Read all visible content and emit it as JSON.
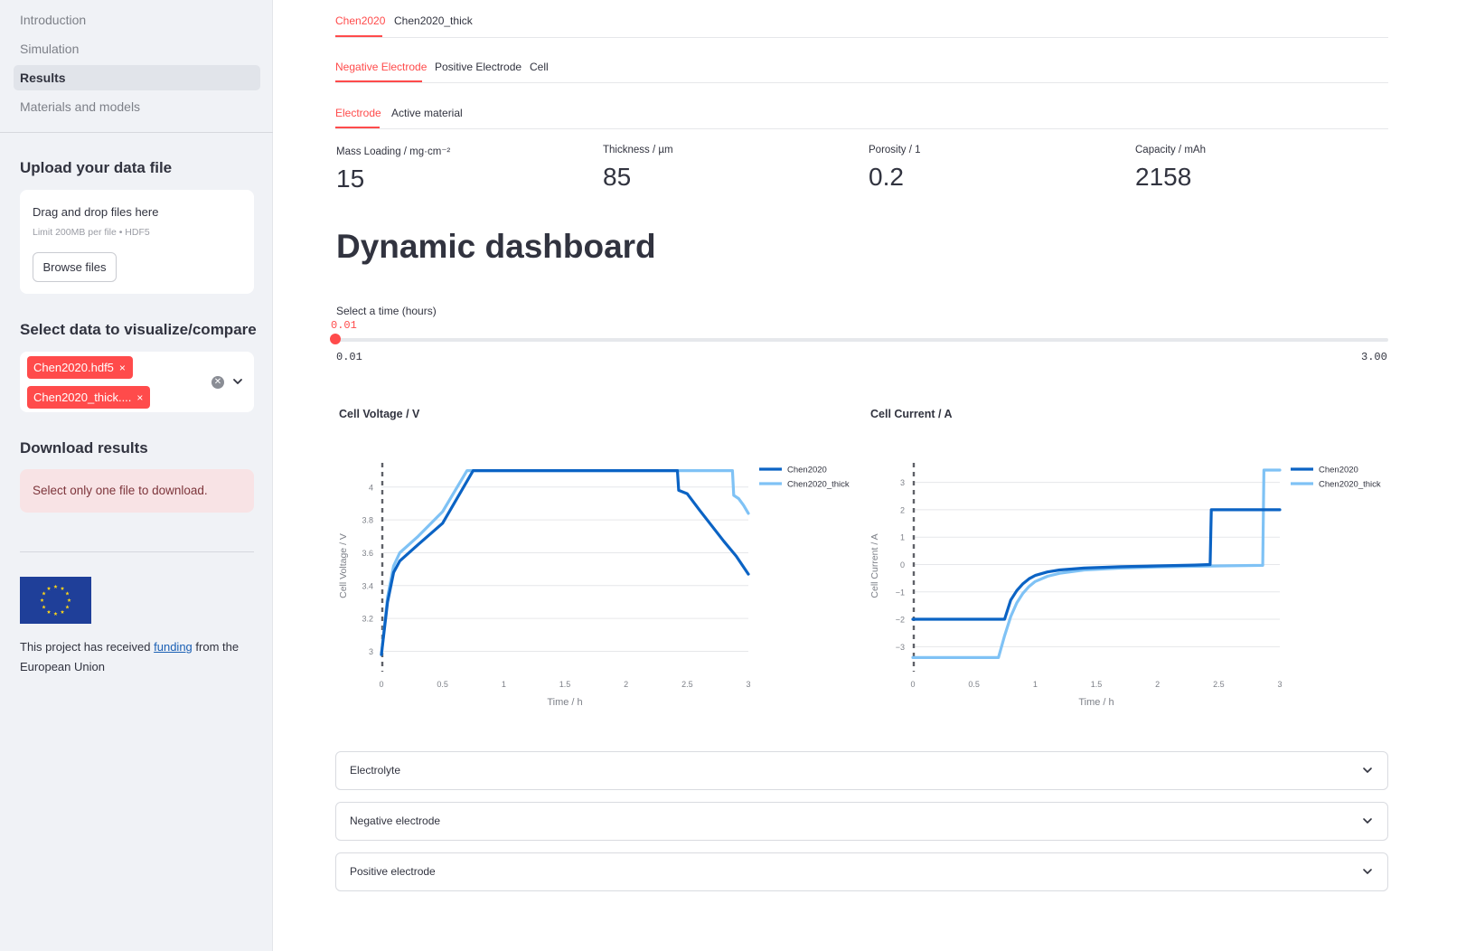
{
  "sidebar": {
    "nav": [
      {
        "label": "Introduction",
        "active": false
      },
      {
        "label": "Simulation",
        "active": false
      },
      {
        "label": "Results",
        "active": true
      },
      {
        "label": "Materials and models",
        "active": false
      }
    ],
    "upload": {
      "heading": "Upload your data file",
      "drop_text": "Drag and drop files here",
      "limit_text": "Limit 200MB per file • HDF5",
      "browse_label": "Browse files"
    },
    "select": {
      "heading": "Select data to visualize/compare",
      "chips": [
        "Chen2020.hdf5",
        "Chen2020_thick...."
      ],
      "chip_close": "×"
    },
    "download": {
      "heading": "Download results",
      "warning": "Select only one file to download."
    },
    "funding": {
      "text_before": "This project has received ",
      "link": "funding",
      "text_after": " from the European Union"
    }
  },
  "tabs": {
    "dataset": [
      "Chen2020",
      "Chen2020_thick"
    ],
    "component": [
      "Negative Electrode",
      "Positive Electrode",
      "Cell"
    ],
    "sub": [
      "Electrode",
      "Active material"
    ]
  },
  "metrics": [
    {
      "label": "Mass Loading / mg·cm⁻²",
      "value": "15"
    },
    {
      "label": "Thickness / µm",
      "value": "85"
    },
    {
      "label": "Porosity / 1",
      "value": "0.2"
    },
    {
      "label": "Capacity / mAh",
      "value": "2158"
    }
  ],
  "dashboard": {
    "title": "Dynamic dashboard",
    "slider": {
      "label": "Select a time (hours)",
      "value": "0.01",
      "min": "0.01",
      "max": "3.00",
      "fraction": 0
    }
  },
  "colors": {
    "accent": "#ff4b4b",
    "series1": "#0b63c4",
    "series2": "#7fc2f5"
  },
  "chart_data": [
    {
      "type": "line",
      "title": "Cell Voltage  /  V",
      "xlabel": "Time  /  h",
      "ylabel": "Cell Voltage  /  V",
      "xlim": [
        0,
        3
      ],
      "ylim": [
        2.92,
        4.12
      ],
      "xticks": [
        0,
        0.5,
        1,
        1.5,
        2,
        2.5,
        3
      ],
      "xtick_labels": [
        "0",
        "0.5",
        "1",
        "1.5",
        "2",
        "2.5",
        "3"
      ],
      "yticks": [
        3,
        3.2,
        3.4,
        3.6,
        3.8,
        4
      ],
      "ytick_labels": [
        "3",
        "3.2",
        "3.4",
        "3.6",
        "3.8",
        "4"
      ],
      "legend": "top-right",
      "series": [
        {
          "name": "Chen2020",
          "color": "#0b63c4",
          "x": [
            0,
            0.05,
            0.1,
            0.15,
            0.3,
            0.5,
            0.75,
            1.0,
            1.5,
            2.0,
            2.4,
            2.42,
            2.43,
            2.5,
            2.6,
            2.8,
            2.9,
            3.0
          ],
          "y": [
            2.98,
            3.3,
            3.48,
            3.55,
            3.65,
            3.78,
            4.1,
            4.1,
            4.1,
            4.1,
            4.1,
            4.1,
            3.98,
            3.96,
            3.86,
            3.67,
            3.58,
            3.47
          ]
        },
        {
          "name": "Chen2020_thick",
          "color": "#7fc2f5",
          "x": [
            0,
            0.05,
            0.1,
            0.15,
            0.3,
            0.5,
            0.7,
            1.0,
            1.5,
            2.0,
            2.5,
            2.85,
            2.87,
            2.88,
            2.92,
            2.96,
            3.0
          ],
          "y": [
            2.98,
            3.33,
            3.52,
            3.6,
            3.7,
            3.85,
            4.1,
            4.1,
            4.1,
            4.1,
            4.1,
            4.1,
            4.1,
            3.95,
            3.93,
            3.89,
            3.84
          ]
        }
      ]
    },
    {
      "type": "line",
      "title": "Cell Current  /  A",
      "xlabel": "Time  /  h",
      "ylabel": "Cell Current  /  A",
      "xlim": [
        0,
        3
      ],
      "ylim": [
        -3.65,
        3.55
      ],
      "xticks": [
        0,
        0.5,
        1,
        1.5,
        2,
        2.5,
        3
      ],
      "xtick_labels": [
        "0",
        "0.5",
        "1",
        "1.5",
        "2",
        "2.5",
        "3"
      ],
      "yticks": [
        -3,
        -2,
        -1,
        0,
        1,
        2,
        3
      ],
      "ytick_labels": [
        "−3",
        "−2",
        "−1",
        "0",
        "1",
        "2",
        "3"
      ],
      "legend": "top-right",
      "series": [
        {
          "name": "Chen2020",
          "color": "#0b63c4",
          "x": [
            0,
            0.75,
            0.8,
            0.85,
            0.9,
            0.95,
            1.0,
            1.1,
            1.2,
            1.4,
            1.7,
            2.0,
            2.3,
            2.43,
            2.44,
            3.0
          ],
          "y": [
            -2.0,
            -2.0,
            -1.3,
            -0.95,
            -0.7,
            -0.52,
            -0.4,
            -0.27,
            -0.2,
            -0.13,
            -0.08,
            -0.05,
            -0.02,
            0.0,
            2.0,
            2.0
          ]
        },
        {
          "name": "Chen2020_thick",
          "color": "#7fc2f5",
          "x": [
            0,
            0.7,
            0.75,
            0.8,
            0.85,
            0.9,
            0.95,
            1.0,
            1.1,
            1.2,
            1.4,
            1.7,
            2.0,
            2.5,
            2.86,
            2.87,
            3.0
          ],
          "y": [
            -3.4,
            -3.4,
            -2.6,
            -1.9,
            -1.4,
            -1.05,
            -0.8,
            -0.62,
            -0.43,
            -0.32,
            -0.2,
            -0.13,
            -0.09,
            -0.05,
            -0.03,
            3.45,
            3.45
          ]
        }
      ]
    }
  ],
  "expanders": [
    "Electrolyte",
    "Negative electrode",
    "Positive electrode"
  ]
}
